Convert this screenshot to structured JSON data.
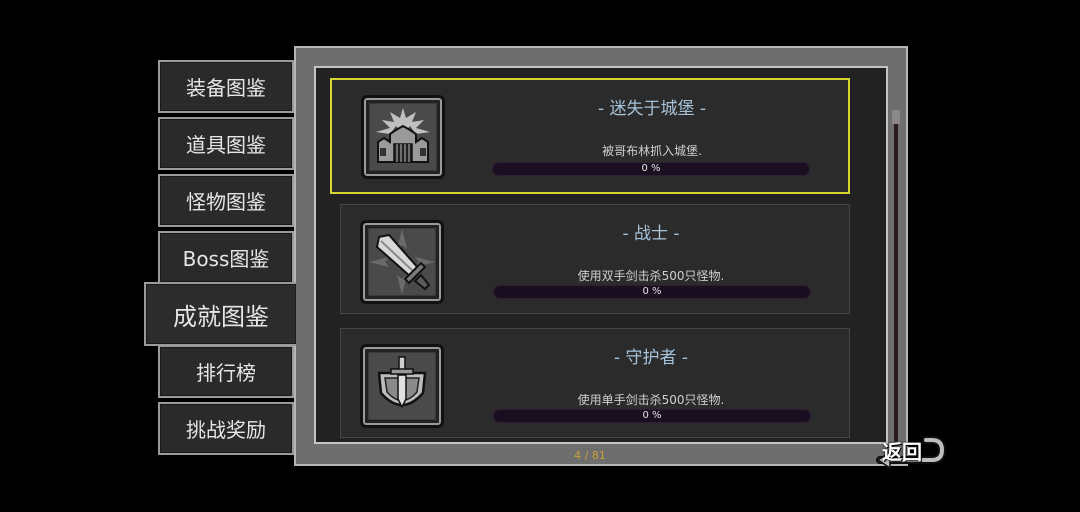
{
  "tabs": [
    {
      "label": "装备图鉴"
    },
    {
      "label": "道具图鉴"
    },
    {
      "label": "怪物图鉴"
    },
    {
      "label": "Boss图鉴"
    },
    {
      "label": "成就图鉴"
    },
    {
      "label": "排行榜"
    },
    {
      "label": "挑战奖励"
    }
  ],
  "active_tab": "成就图鉴",
  "achievements": [
    {
      "title": "- 迷失于城堡 -",
      "desc": "被哥布林抓入城堡.",
      "progress_text": "0 %",
      "progress": 0,
      "icon": "castle-icon",
      "selected": true
    },
    {
      "title": "- 战士 -",
      "desc": "使用双手剑击杀500只怪物.",
      "progress_text": "0 %",
      "progress": 0,
      "icon": "greatsword-icon",
      "selected": false
    },
    {
      "title": "- 守护者 -",
      "desc": "使用单手剑击杀500只怪物.",
      "progress_text": "0 %",
      "progress": 0,
      "icon": "sword-shield-icon",
      "selected": false
    }
  ],
  "pagination": "4 / 81",
  "back_label": "返回",
  "colors": {
    "selected_border": "#d6d631",
    "title": "#a7c3da",
    "page_text": "#c9a03a"
  }
}
